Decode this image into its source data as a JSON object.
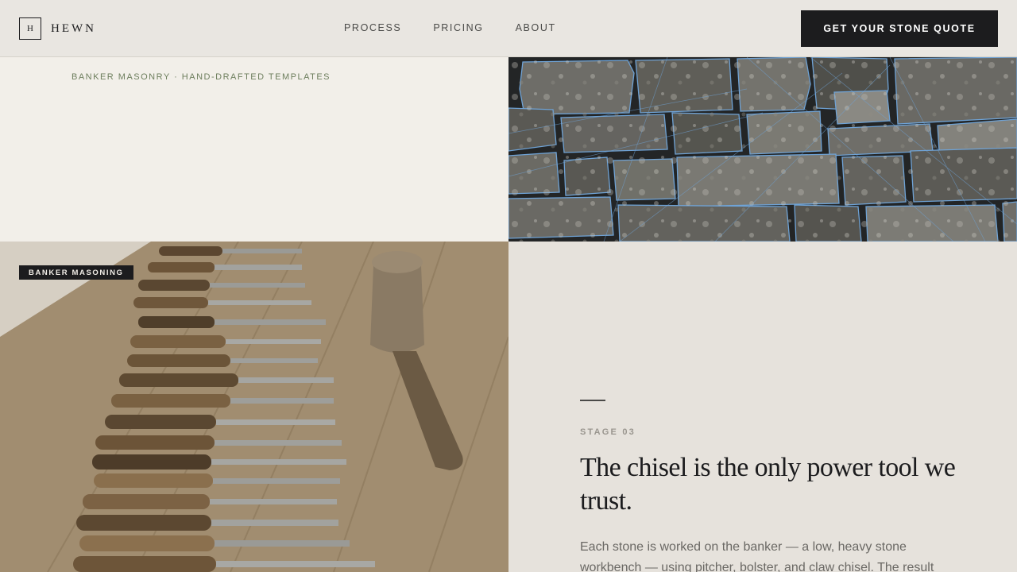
{
  "header": {
    "logo_mark": "H",
    "logo_word": "HEWN",
    "nav": [
      "PROCESS",
      "PRICING",
      "ABOUT"
    ],
    "cta_label": "GET YOUR STONE QUOTE"
  },
  "intro": {
    "eyebrow": "BANKER MASONRY · HAND-DRAFTED TEMPLATES"
  },
  "workbench": {
    "badge": "BANKER MASONING"
  },
  "stage": {
    "label": "STAGE 03",
    "headline": "The chisel is the only power tool we trust.",
    "body": "Each stone is worked on the banker — a low, heavy stone workbench — using pitcher, bolster, and claw chisel. The result"
  },
  "colors": {
    "ink": "#1c1c1e",
    "cream": "#f2efe9",
    "sand": "#e6e2dc",
    "sage": "#6d7e5d",
    "template_line": "#6fa3d6"
  }
}
